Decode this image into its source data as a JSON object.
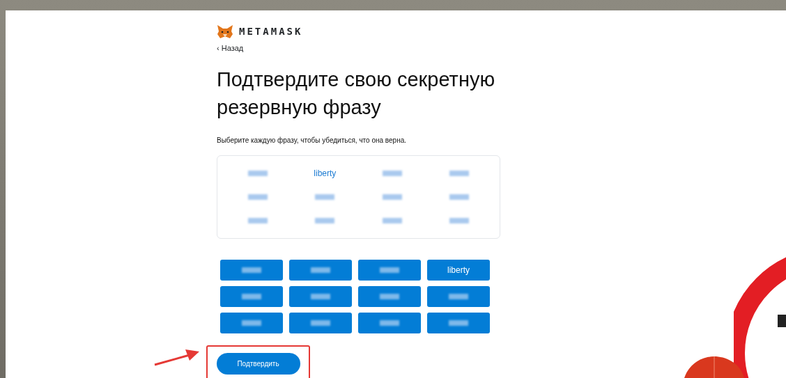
{
  "logo": {
    "text": "METAMASK"
  },
  "back_link": {
    "text": "‹ Назад"
  },
  "heading": "Подтвердите свою секретную резервную фразу",
  "instruction": "Выберите каждую фразу, чтобы убедиться, что она верна.",
  "chosen_words": [
    {
      "kind": "blurred"
    },
    {
      "kind": "word",
      "text": "liberty"
    },
    {
      "kind": "blurred"
    },
    {
      "kind": "blurred"
    },
    {
      "kind": "blurred"
    },
    {
      "kind": "blurred"
    },
    {
      "kind": "blurred"
    },
    {
      "kind": "blurred"
    },
    {
      "kind": "blurred"
    },
    {
      "kind": "blurred"
    },
    {
      "kind": "blurred"
    },
    {
      "kind": "blurred"
    }
  ],
  "word_buttons": [
    {
      "kind": "blurred"
    },
    {
      "kind": "blurred"
    },
    {
      "kind": "blurred"
    },
    {
      "kind": "word",
      "text": "liberty"
    },
    {
      "kind": "blurred"
    },
    {
      "kind": "blurred"
    },
    {
      "kind": "blurred"
    },
    {
      "kind": "blurred"
    },
    {
      "kind": "blurred"
    },
    {
      "kind": "blurred"
    },
    {
      "kind": "blurred"
    },
    {
      "kind": "blurred"
    }
  ],
  "confirm_button": {
    "text": "Подтвердить",
    "highlighted": true
  }
}
